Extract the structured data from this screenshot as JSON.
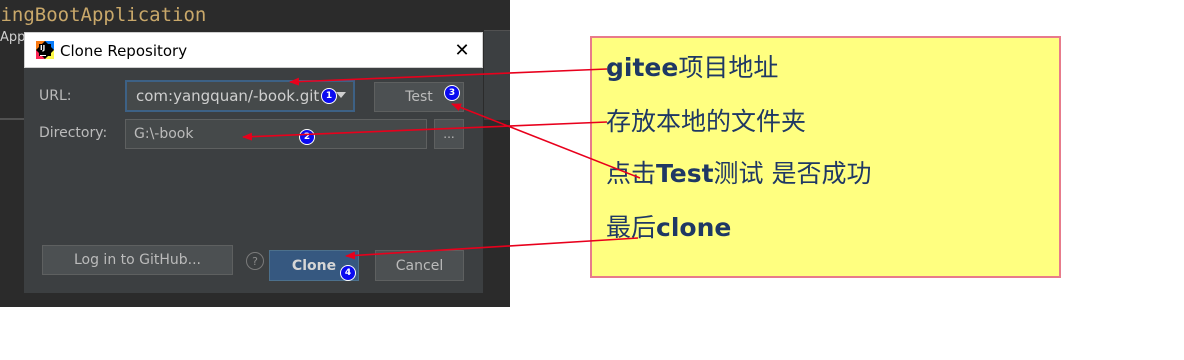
{
  "ide": {
    "code_text": "ringBootApplication",
    "side_text": "App"
  },
  "dialog": {
    "title": "Clone Repository",
    "url_label": "URL:",
    "url_value": "com:yangquan/-book.git",
    "directory_label": "Directory:",
    "directory_value": "G:\\-book",
    "test_label": "Test",
    "browse_label": "...",
    "login_label": "Log in to GitHub...",
    "help_label": "?",
    "clone_label": "Clone",
    "cancel_label": "Cancel",
    "close_glyph": "✕"
  },
  "markers": [
    "1",
    "2",
    "3",
    "4"
  ],
  "annotation": {
    "line1_bold": "gitee",
    "line1_rest": "项目地址",
    "line2": "存放本地的文件夹",
    "line3_pre": "点击",
    "line3_bold": "Test",
    "line3_rest": "测试  是否成功",
    "line4_pre": "最后",
    "line4_bold": "clone"
  },
  "colors": {
    "note_background": "#ffff80",
    "note_border": "#e87b8b",
    "note_text": "#1f3864",
    "arrow": "#e8001c",
    "marker": "#0a0af0"
  }
}
